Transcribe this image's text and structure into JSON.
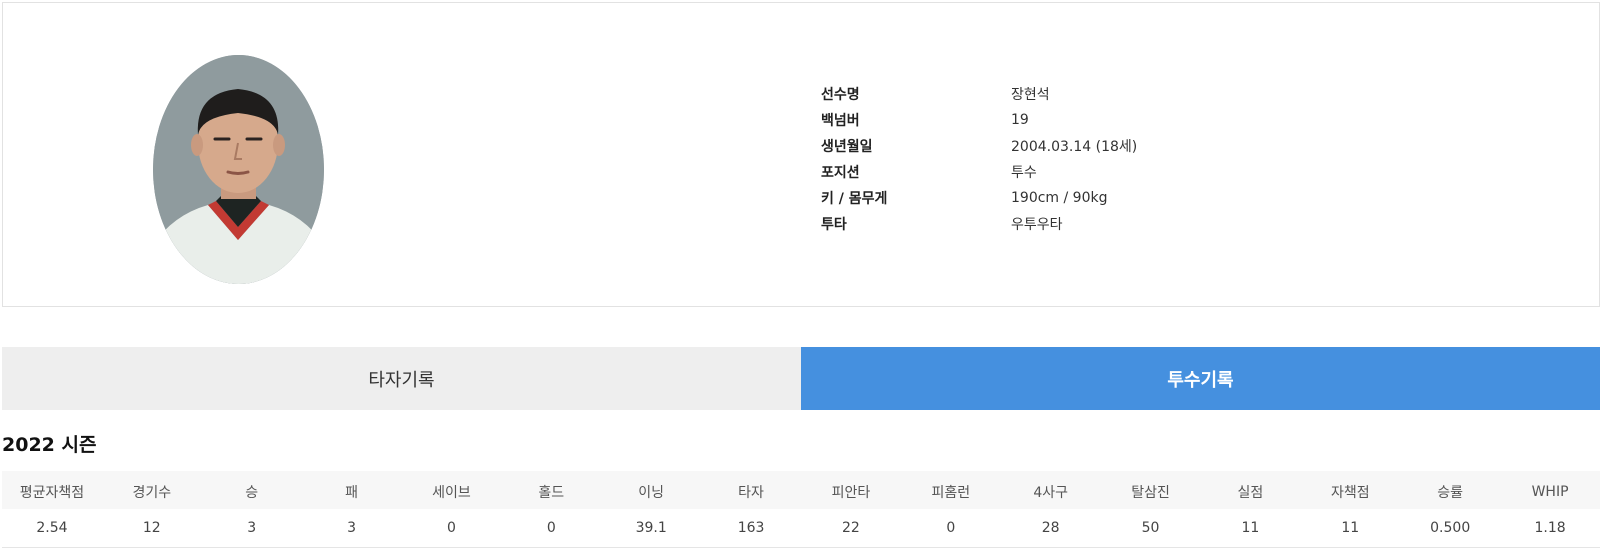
{
  "player": {
    "name_label": "선수명",
    "name_value": "장현석",
    "number_label": "백넘버",
    "number_value": "19",
    "birth_label": "생년월일",
    "birth_value": "2004.03.14 (18세)",
    "position_label": "포지션",
    "position_value": "투수",
    "size_label": "키 / 몸무게",
    "size_value": "190cm / 90kg",
    "hand_label": "투타",
    "hand_value": "우투우타"
  },
  "tabs": {
    "batting": "타자기록",
    "pitching": "투수기록",
    "active": "pitching"
  },
  "season": {
    "title": "2022 시즌"
  },
  "stats": {
    "headers": [
      "평균자책점",
      "경기수",
      "승",
      "패",
      "세이브",
      "홀드",
      "이닝",
      "타자",
      "피안타",
      "피홈런",
      "4사구",
      "탈삼진",
      "실점",
      "자책점",
      "승률",
      "WHIP"
    ],
    "values": [
      "2.54",
      "12",
      "3",
      "3",
      "0",
      "0",
      "39.1",
      "163",
      "22",
      "0",
      "28",
      "50",
      "11",
      "11",
      "0.500",
      "1.18"
    ]
  },
  "colors": {
    "active_tab": "#4590df",
    "inactive_tab": "#eeeeee",
    "table_bar": "#0d3b8c",
    "table_bar_accent": "#3fb7e0"
  }
}
